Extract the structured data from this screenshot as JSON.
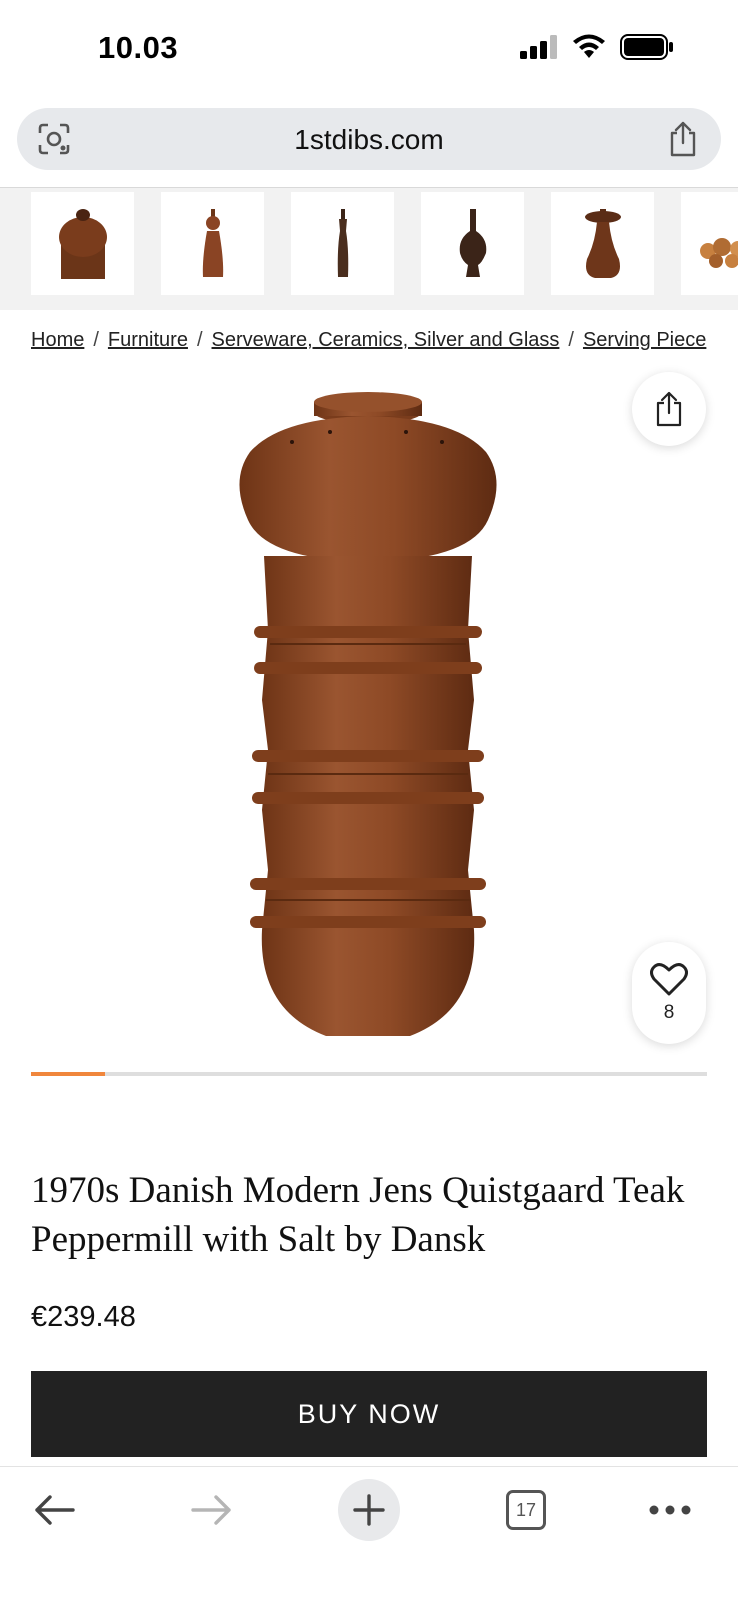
{
  "status_bar": {
    "time": "10.03"
  },
  "browser": {
    "url": "1stdibs.com",
    "open_tabs": "17"
  },
  "thumbnails": [
    {
      "alt": "thumbnail-1"
    },
    {
      "alt": "thumbnail-2"
    },
    {
      "alt": "thumbnail-3"
    },
    {
      "alt": "thumbnail-4"
    },
    {
      "alt": "thumbnail-5"
    },
    {
      "alt": "thumbnail-6"
    }
  ],
  "breadcrumb": {
    "items": [
      "Home",
      "Furniture",
      "Serveware, Ceramics, Silver and Glass",
      "Serving Piece"
    ],
    "separator": "/"
  },
  "product": {
    "favorites_count": "8",
    "gallery_progress": 0.11,
    "title": "1970s Danish Modern Jens Quistgaard Teak Peppermill with Salt by Dansk",
    "price": "€239.48",
    "buy_label": "BUY NOW"
  },
  "colors": {
    "accent": "#f0863c",
    "button_dark": "#222222",
    "teak": "#8a4a26"
  }
}
